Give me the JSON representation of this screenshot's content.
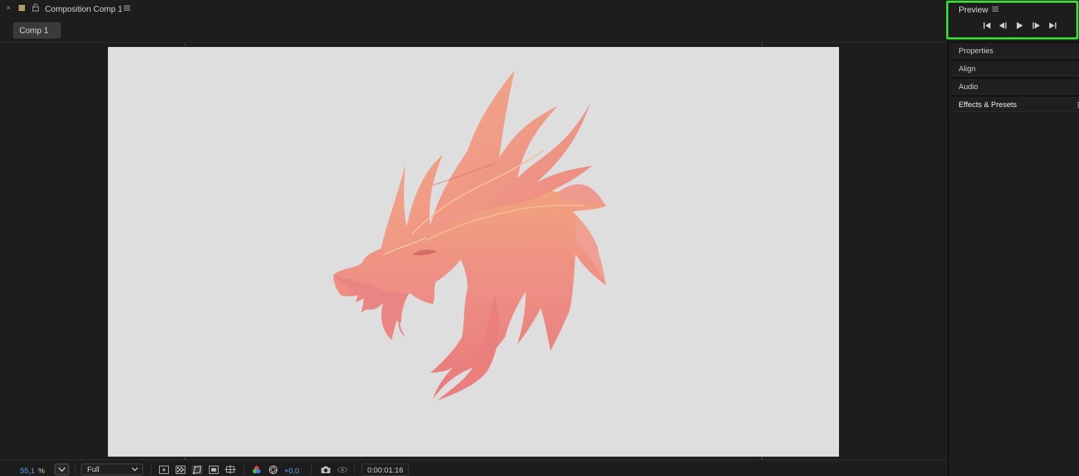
{
  "composition_panel": {
    "header_title": "Composition Comp 1",
    "tab_label": "Comp 1",
    "close_glyph": "×"
  },
  "toolbar": {
    "zoom_value": "55,1",
    "zoom_unit": "%",
    "resolution": "Full",
    "exposure": "+0,0",
    "timecode": "0:00:01:16"
  },
  "right_panels": {
    "preview": {
      "title": "Preview"
    },
    "items": [
      {
        "label": "Properties"
      },
      {
        "label": "Align"
      },
      {
        "label": "Audio"
      },
      {
        "label": "Effects & Presets"
      }
    ]
  },
  "colors": {
    "background": "#1d1d1d",
    "canvas": "#dedede",
    "artwork": "#ec8a86",
    "accent_blue": "#5aa0f0",
    "highlight": "#2ee62a"
  },
  "icons": {
    "transport": [
      "skip-to-start-icon",
      "step-back-icon",
      "play-icon",
      "step-forward-icon",
      "skip-to-end-icon"
    ],
    "toolbar": [
      "fast-preview-icon",
      "transparency-grid-icon",
      "mask-path-icon",
      "region-of-interest-icon",
      "grid-guides-icon",
      "color-channels-icon",
      "reset-exposure-icon",
      "snapshot-camera-icon",
      "show-snapshot-icon"
    ]
  }
}
